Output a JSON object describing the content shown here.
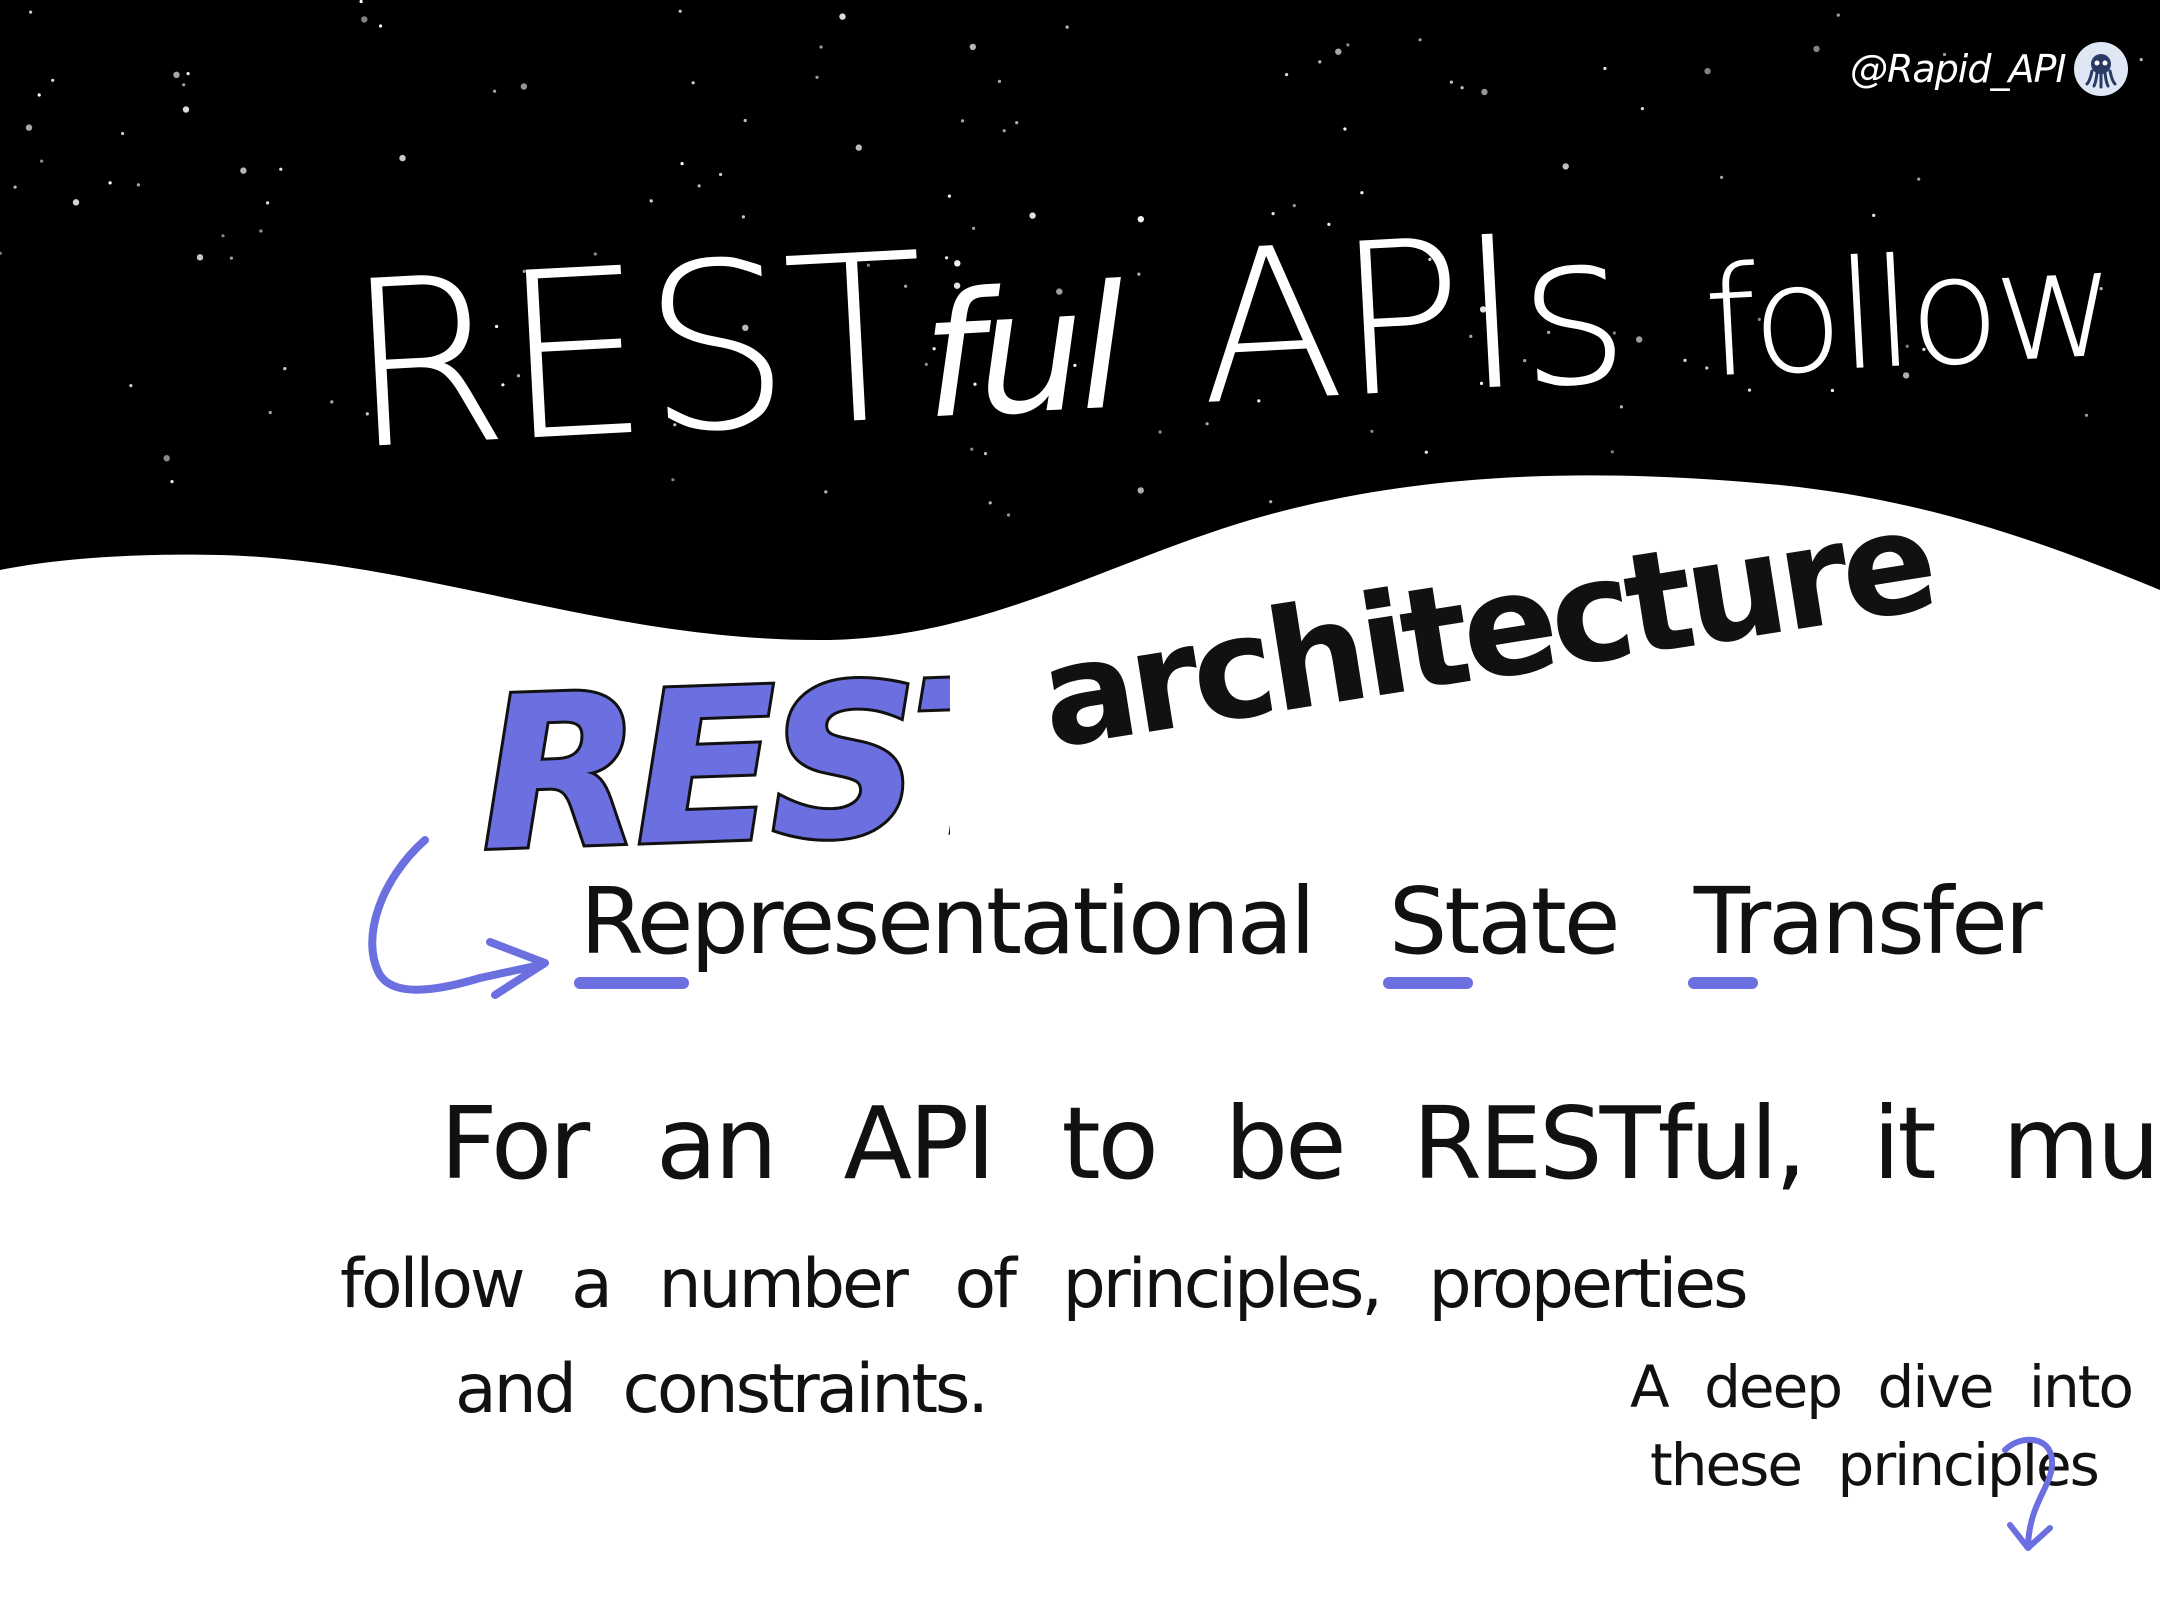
{
  "background": {
    "sky_color": "#000000",
    "ground_color": "#ffffff",
    "accent_color": "#6c6fe0"
  },
  "handle": {
    "text": "@Rapid_API",
    "icon": "octopus-logo-icon"
  },
  "headline": {
    "rest": "REST",
    "ful": "ful",
    "apis": "APIs",
    "follow": "follow"
  },
  "emphasis": {
    "rest": "REST",
    "architecture": "architecture"
  },
  "expansion": {
    "arrow_icon": "curved-arrow-icon",
    "words": [
      "Representational",
      "State",
      "Transfer"
    ]
  },
  "body": {
    "line1": "For an API to be RESTful, it must",
    "line2": "follow a number of principles, properties",
    "line3": "and constraints."
  },
  "footer_note": {
    "line1": "A deep dive into",
    "line2": "these principles",
    "arrow_icon": "down-arrow-icon"
  }
}
